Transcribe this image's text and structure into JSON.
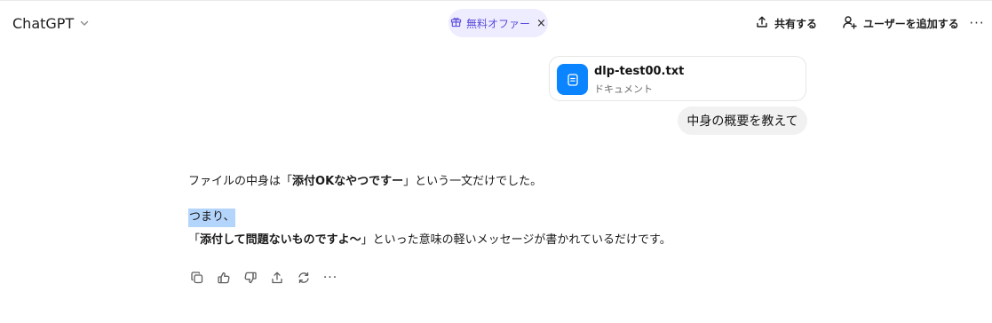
{
  "header": {
    "model_name": "ChatGPT",
    "offer_label": "無料オファー",
    "offer_close": "×",
    "share_label": "共有する",
    "add_user_label": "ユーザーを追加する",
    "more_label": "···"
  },
  "attachment": {
    "file_name": "dlp-test00.txt",
    "file_type": "ドキュメント"
  },
  "user_message": "中身の概要を教えて",
  "assistant": {
    "line1_pre": "ファイルの中身は「",
    "line1_bold": "添付OKなやつですー",
    "line1_post": "」という一文だけでした。",
    "line2_highlighted": "つまり、",
    "line3_pre": "「",
    "line3_bold": "添付して問題ないものですよ〜",
    "line3_post": "」といった意味の軽いメッセージが書かれているだけです。"
  },
  "actions": {
    "icons": [
      "copy-icon",
      "thumbs-up-icon",
      "thumbs-down-icon",
      "share-icon",
      "regenerate-icon",
      "more-icon"
    ],
    "more_label": "···"
  },
  "colors": {
    "offer_bg": "#eeecff",
    "offer_text": "#5b4cdb",
    "file_icon_bg": "#0b85ff",
    "user_bubble_bg": "#f1f1f1",
    "selection_highlight": "#b4d5fb"
  }
}
